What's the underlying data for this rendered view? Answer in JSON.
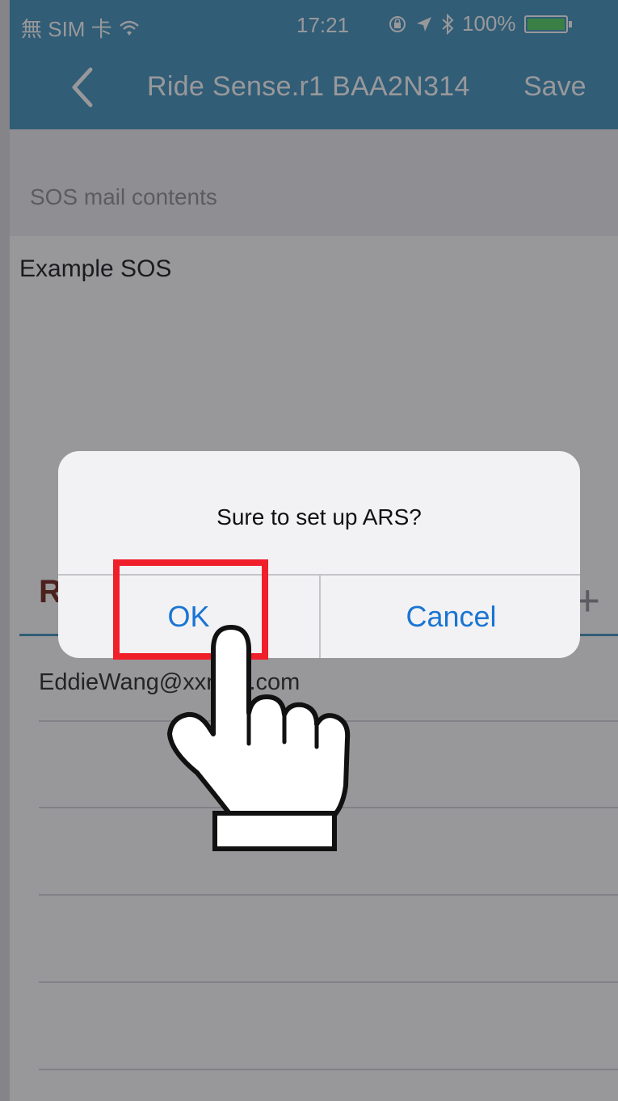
{
  "status_bar": {
    "carrier": "無 SIM 卡",
    "time": "17:21",
    "battery": "100%"
  },
  "nav": {
    "title": "Ride Sense.r1 BAA2N314",
    "save_label": "Save"
  },
  "sos": {
    "section_label": "SOS mail contents",
    "body_text": "Example SOS"
  },
  "recipients": {
    "title_partial": "R",
    "emails": [
      "EddieWang@xxmail.com"
    ]
  },
  "alert": {
    "message": "Sure to set up ARS?",
    "ok_label": "OK",
    "cancel_label": "Cancel"
  },
  "colors": {
    "nav_bar": "#3a8fb9",
    "alert_button": "#1a75d2",
    "highlight": "#f0202b"
  }
}
